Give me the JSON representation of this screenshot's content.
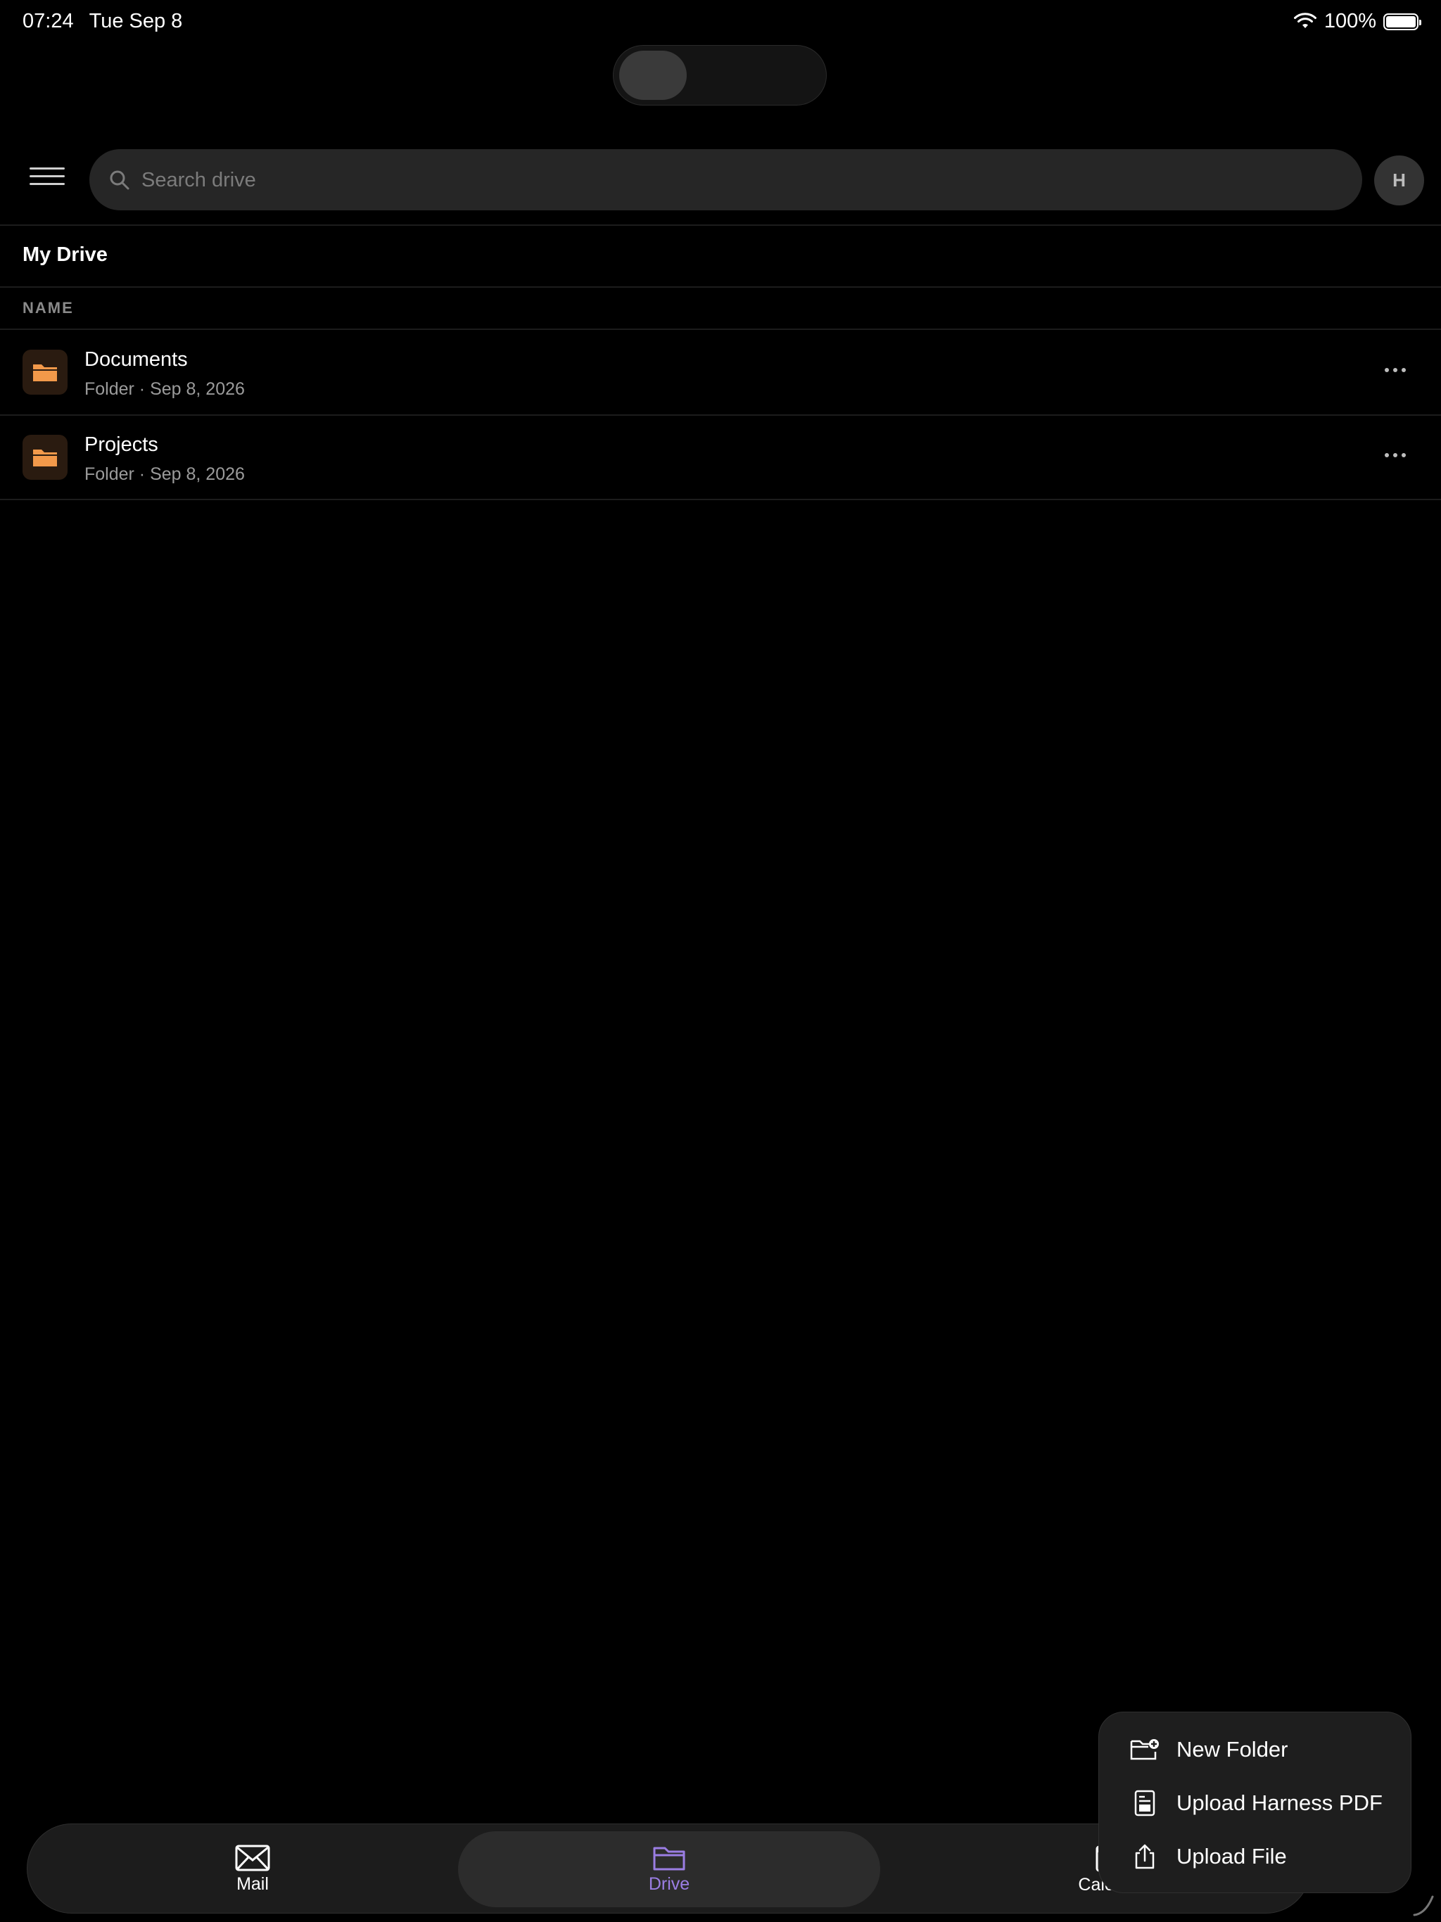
{
  "status_bar": {
    "time": "07:24",
    "date": "Tue Sep 8",
    "battery": "100%"
  },
  "search": {
    "placeholder": "Search drive"
  },
  "account": {
    "avatar_initial": "H"
  },
  "page": {
    "title": "My Drive",
    "column_header": "NAME"
  },
  "items": [
    {
      "name": "Documents",
      "meta": "Folder · Sep 8, 2026"
    },
    {
      "name": "Projects",
      "meta": "Folder · Sep 8, 2026"
    }
  ],
  "bottom_nav": {
    "mail": "Mail",
    "drive": "Drive",
    "calendar": "Calenda"
  },
  "popup_menu": {
    "new_folder": "New Folder",
    "upload_pdf": "Upload Harness PDF",
    "upload_file": "Upload File"
  },
  "colors": {
    "accent": "#9b7ee4",
    "folder": "#f2994a",
    "background": "#000000"
  }
}
